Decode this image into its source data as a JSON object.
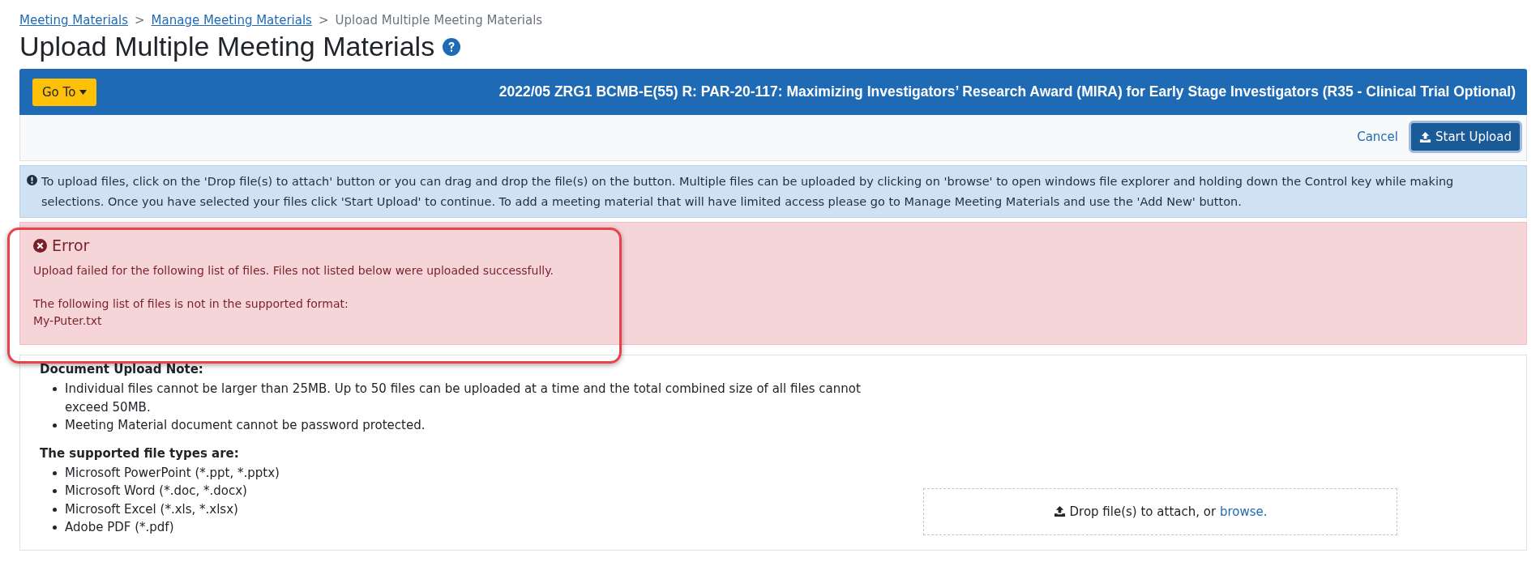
{
  "breadcrumb": [
    {
      "label": "Meeting Materials",
      "link": true
    },
    {
      "label": "Manage Meeting Materials",
      "link": true
    },
    {
      "label": "Upload Multiple Meeting Materials",
      "link": false
    }
  ],
  "breadcrumb_separator": ">",
  "page_title": "Upload Multiple Meeting Materials",
  "header": {
    "goto_button": "Go To",
    "title": "2022/05 ZRG1 BCMB-E(55) R: PAR-20-117: Maximizing Investigators’ Research Award (MIRA) for Early Stage Investigators (R35 - Clinical Trial Optional)"
  },
  "toolbar": {
    "cancel": "Cancel",
    "start_upload": "Start Upload"
  },
  "info": "To upload files, click on the 'Drop file(s) to attach' button or you can drag and drop the file(s) on the button. Multiple files can be uploaded by clicking on 'browse' to open windows file explorer and holding down the Control key while making selections. Once you have selected your files click 'Start Upload' to continue. To add a meeting material that will have limited access please go to Manage Meeting Materials and use the 'Add New' button.",
  "error": {
    "title": "Error",
    "message": "Upload failed for the following list of files. Files not listed below were uploaded successfully.",
    "format_heading": "The following list of files is not in the supported format:",
    "files": [
      "My-Puter.txt"
    ],
    "highlighted": true
  },
  "note": {
    "heading": "Document Upload Note:",
    "items": [
      "Individual files cannot be larger than 25MB. Up to 50 files can be uploaded at a time and the total combined size of all files cannot exceed 50MB.",
      "Meeting Material document cannot be password protected."
    ],
    "types_heading": "The supported file types are:",
    "types": [
      "Microsoft PowerPoint (*.ppt, *.pptx)",
      "Microsoft Word (*.doc, *.docx)",
      "Microsoft Excel (*.xls, *.xlsx)",
      "Adobe PDF (*.pdf)"
    ]
  },
  "dropzone": {
    "text": "Drop file(s) to attach, or",
    "link": "browse."
  }
}
